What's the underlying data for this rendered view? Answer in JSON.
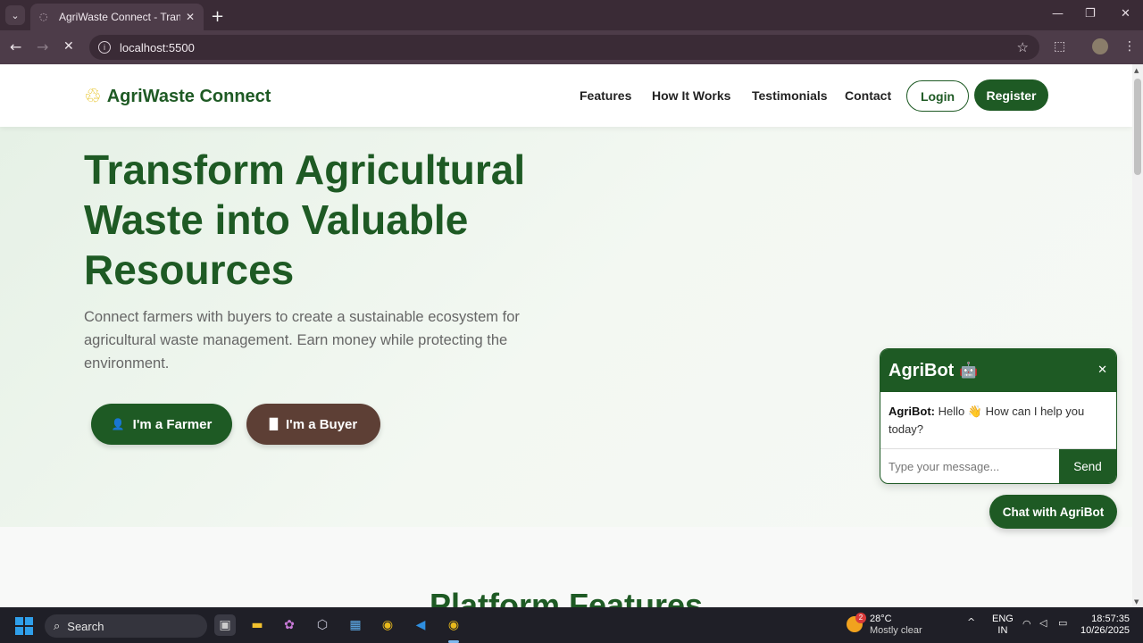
{
  "browser": {
    "tab_title": "AgriWaste Connect - Transform",
    "url": "localhost:5500"
  },
  "site": {
    "brand": "AgriWaste Connect",
    "nav": [
      "Features",
      "How It Works",
      "Testimonials",
      "Contact"
    ],
    "login_label": "Login",
    "register_label": "Register"
  },
  "hero": {
    "title": "Transform Agricultural Waste into Valuable Resources",
    "subtitle": "Connect farmers with buyers to create a sustainable ecosystem for agricultural waste management. Earn money while protecting the environment.",
    "farmer_button": "I'm a Farmer",
    "buyer_button": "I'm a Buyer"
  },
  "features": {
    "title": "Platform Features"
  },
  "chatbot": {
    "title": "AgriBot",
    "sender": "AgriBot:",
    "message": "Hello 👋 How can I help you today?",
    "input_placeholder": "Type your message...",
    "send_label": "Send",
    "toggle_label": "Chat with AgriBot"
  },
  "taskbar": {
    "search_label": "Search",
    "weather_temp": "28°C",
    "weather_desc": "Mostly clear",
    "weather_badge": "2",
    "lang_line1": "ENG",
    "lang_line2": "IN",
    "time": "18:57:35",
    "date": "10/26/2025"
  },
  "colors": {
    "brand_green": "#1e5a24",
    "buyer_brown": "#5d3f35",
    "logo_yellow": "#e6c11b"
  }
}
